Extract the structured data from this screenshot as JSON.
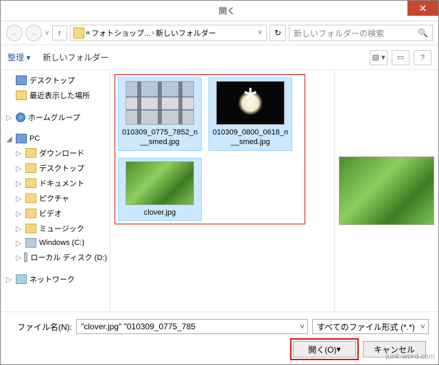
{
  "title": "開く",
  "nav": {
    "path_crumb1": "フォトショップ...",
    "path_crumb2": "新しいフォルダー",
    "search_placeholder": "新しいフォルダーの検索"
  },
  "toolbar": {
    "organize": "整理",
    "new_folder": "新しいフォルダー"
  },
  "tree": {
    "desktop": "デスクトップ",
    "recent": "最近表示した場所",
    "homegroup": "ホームグループ",
    "pc": "PC",
    "downloads": "ダウンロード",
    "desktop2": "デスクトップ",
    "documents": "ドキュメント",
    "pictures": "ピクチャ",
    "videos": "ビデオ",
    "music": "ミュージック",
    "cdrive": "Windows (C:)",
    "ddrive": "ローカル ディスク (D:)",
    "network": "ネットワーク"
  },
  "files": {
    "f1": "010309_0775_7852_n__smed.jpg",
    "f2": "010309_0800_0618_n__smed.jpg",
    "f3": "clover.jpg"
  },
  "footer": {
    "filename_label": "ファイル名(N):",
    "filename_value": "\"clover.jpg\" \"010309_0775_785",
    "filter": "すべてのファイル形式 (*.*)",
    "open_btn": "開く(O)",
    "cancel_btn": "キャンセル"
  },
  "watermark": "junk-word.com"
}
